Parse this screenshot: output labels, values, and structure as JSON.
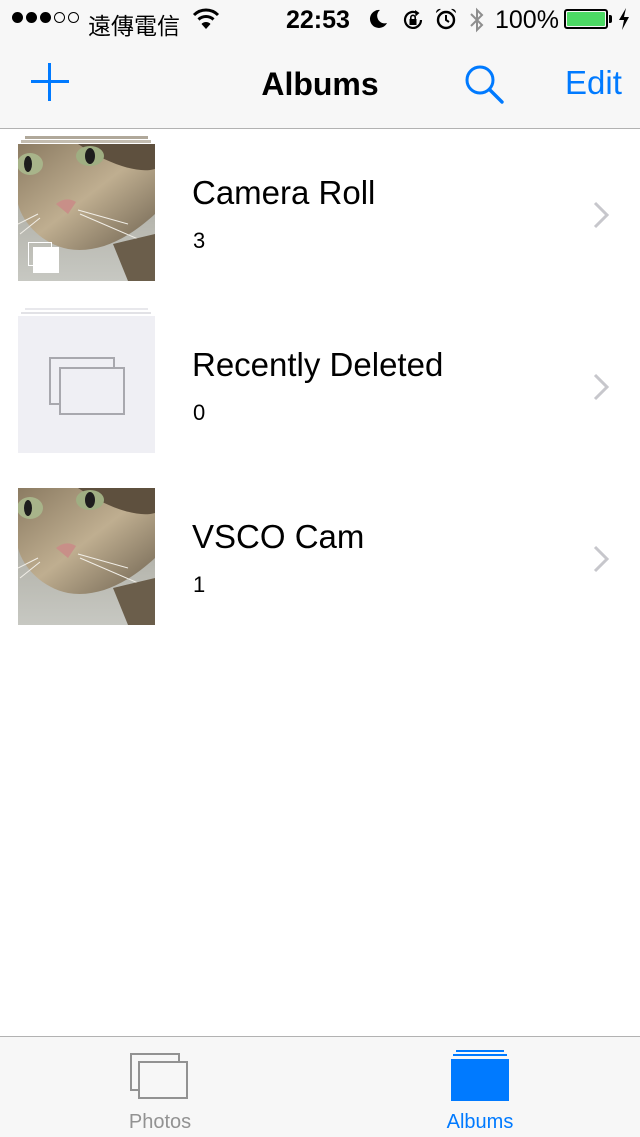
{
  "status_bar": {
    "signal_dots": [
      true,
      true,
      true,
      false,
      false
    ],
    "carrier": "遠傳電信",
    "time": "22:53",
    "battery_text": "100%",
    "battery_level": 1.0,
    "icons": [
      "wifi-icon",
      "moon-icon",
      "rotation-lock-icon",
      "alarm-icon",
      "bluetooth-icon",
      "battery-icon",
      "charging-icon"
    ]
  },
  "nav": {
    "title": "Albums",
    "edit_label": "Edit",
    "icons": [
      "plus-icon",
      "search-icon"
    ]
  },
  "albums": [
    {
      "name": "Camera Roll",
      "count": "3",
      "thumbnail": "cat-photo-with-stack-badge"
    },
    {
      "name": "Recently Deleted",
      "count": "0",
      "thumbnail": "empty-album-placeholder"
    },
    {
      "name": "VSCO Cam",
      "count": "1",
      "thumbnail": "cat-photo"
    }
  ],
  "tabs": [
    {
      "label": "Photos",
      "icon": "photos-tab-icon",
      "selected": false
    },
    {
      "label": "Albums",
      "icon": "albums-tab-icon",
      "selected": true
    }
  ],
  "colors": {
    "accent": "#007aff",
    "battery_green": "#4cd964",
    "bar_background": "#f7f7f7",
    "inactive_tab": "#929292"
  }
}
